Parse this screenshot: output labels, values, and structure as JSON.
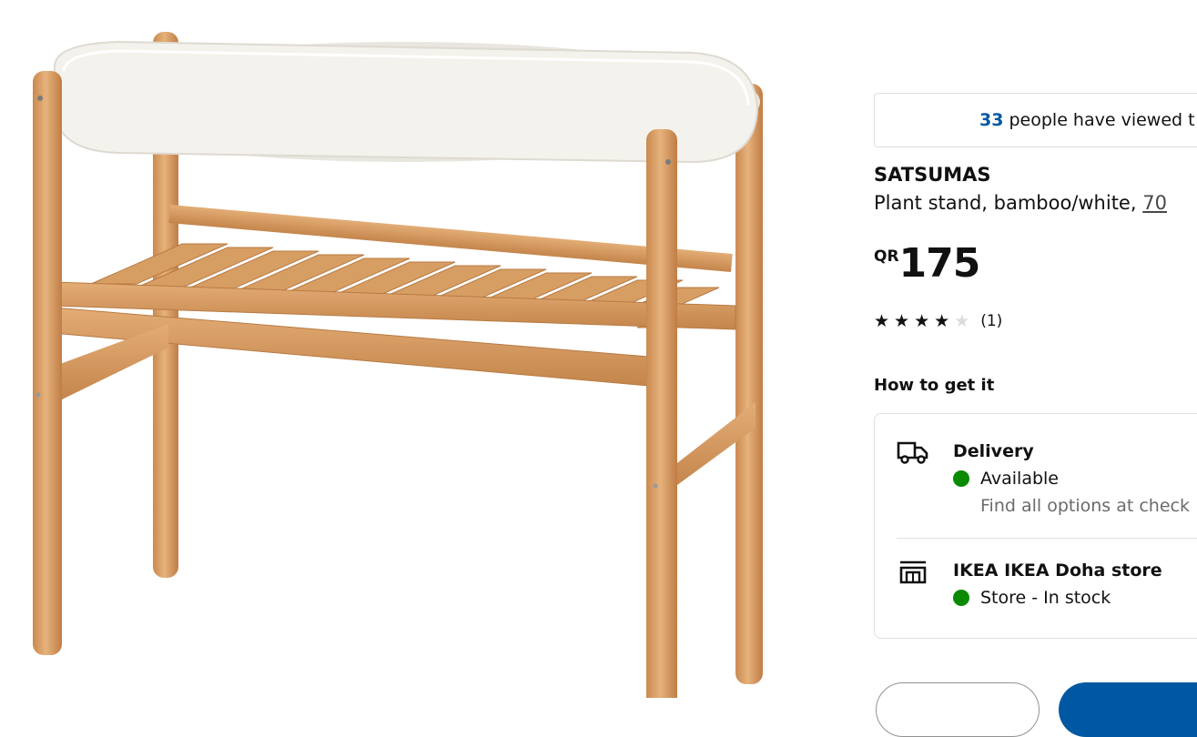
{
  "banner": {
    "count": "33",
    "text": " people have viewed t"
  },
  "product": {
    "name": "SATSUMAS",
    "description": "Plant stand, bamboo/white, ",
    "size_link": "70 "
  },
  "price": {
    "currency": "QR",
    "amount": "175"
  },
  "rating": {
    "stars": [
      1,
      1,
      1,
      1,
      0
    ],
    "value": 4,
    "max": 5,
    "count_label": "(1)"
  },
  "availability": {
    "heading": "How to get it",
    "delivery": {
      "icon": "truck-icon",
      "title": "Delivery",
      "status": "Available",
      "note": "Find all options at check"
    },
    "store": {
      "icon": "store-icon",
      "title": "IKEA IKEA Doha store",
      "status": "Store - In stock"
    },
    "status_color": "#0a8a00"
  },
  "colors": {
    "accent": "#0058a3",
    "bamboo": "#d9a16a",
    "top_white": "#f4f2ec"
  }
}
